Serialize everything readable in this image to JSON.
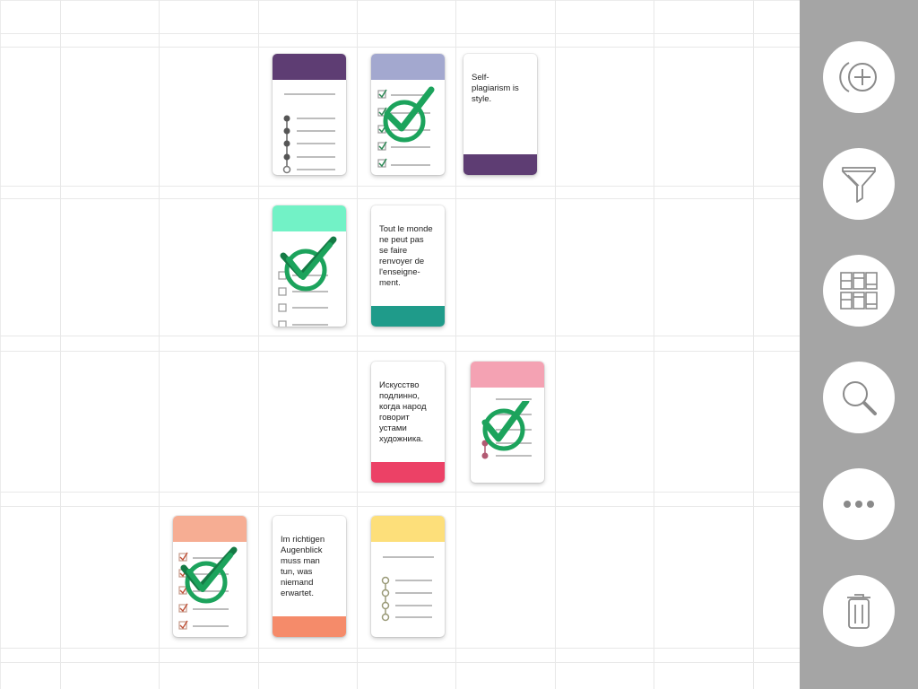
{
  "board": {
    "cards": [
      {
        "id": "c1",
        "kind": "checklist",
        "top_color": "#5e3d73",
        "items": [
          "dot-filled",
          "dot-filled",
          "dot-filled",
          "dot-filled",
          "dot-empty"
        ],
        "completed": false
      },
      {
        "id": "c2",
        "kind": "checklist",
        "top_color": "#a3a8cf",
        "items": [
          "box-checked",
          "box-checked",
          "box-checked",
          "box-checked",
          "box-checked"
        ],
        "completed": true
      },
      {
        "id": "c3",
        "kind": "quote",
        "bottom_color": "#5e3d73",
        "text": "Self-\nplagiarism is\nstyle."
      },
      {
        "id": "c4",
        "kind": "checklist",
        "top_color": "#72f2c6",
        "items": [
          "box",
          "box",
          "box",
          "box",
          "box"
        ],
        "completed": true
      },
      {
        "id": "c5",
        "kind": "quote",
        "bottom_color": "#1f9b8a",
        "text": "Tout le monde\nne peut pas\nse faire\nrenvoyer de\nl'enseigne-\nment."
      },
      {
        "id": "c6",
        "kind": "quote",
        "bottom_color": "#ec4166",
        "text": "Искусство\nподлинно,\nкогда народ\nговорит\nустами\nхудожника."
      },
      {
        "id": "c7",
        "kind": "checklist",
        "top_color": "#f4a2b3",
        "items": [
          "none",
          "none",
          "none",
          "dot-filled",
          "dot-filled"
        ],
        "completed": true
      },
      {
        "id": "c8",
        "kind": "checklist",
        "top_color": "#f6ad93",
        "items": [
          "box-checked",
          "box-checked",
          "box-checked",
          "box-checked",
          "box-checked"
        ],
        "completed": true
      },
      {
        "id": "c9",
        "kind": "quote",
        "bottom_color": "#f58b6a",
        "text": "Im richtigen\nAugenblick\nmuss man\ntun, was\nniemand\nerwartet."
      },
      {
        "id": "c10",
        "kind": "checklist",
        "top_color": "#fddf7a",
        "items": [
          "dot-empty",
          "dot-empty",
          "dot-empty",
          "dot-empty"
        ],
        "completed": false
      }
    ]
  },
  "toolbar": {
    "buttons": [
      {
        "name": "add-button",
        "icon": "add-circle-icon"
      },
      {
        "name": "filter-button",
        "icon": "funnel-icon"
      },
      {
        "name": "layout-button",
        "icon": "grid-layout-icon"
      },
      {
        "name": "search-button",
        "icon": "magnifier-icon"
      },
      {
        "name": "more-button",
        "icon": "more-dots-icon"
      },
      {
        "name": "delete-button",
        "icon": "trash-icon"
      }
    ]
  },
  "colors": {
    "check_green": "#1ca35c",
    "check_dark": "#157a45",
    "toolbar_bg": "#a5a5a5",
    "icon_gray": "#8a8a8a"
  }
}
